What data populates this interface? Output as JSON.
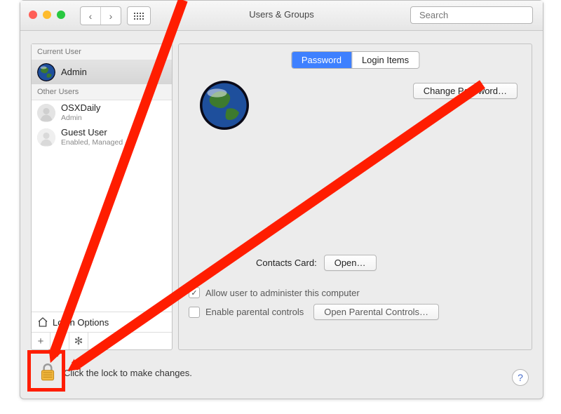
{
  "titlebar": {
    "title": "Users & Groups",
    "search_placeholder": "Search"
  },
  "sidebar": {
    "current_header": "Current User",
    "other_header": "Other Users",
    "users": [
      {
        "name": "Admin",
        "role": ""
      },
      {
        "name": "OSXDaily",
        "role": "Admin"
      },
      {
        "name": "Guest User",
        "role": "Enabled, Managed"
      }
    ],
    "login_options": "Login Options"
  },
  "main": {
    "tabs": [
      {
        "label": "Password",
        "active": true
      },
      {
        "label": "Login Items",
        "active": false
      }
    ],
    "change_password": "Change Password…",
    "contacts_label": "Contacts Card:",
    "open_button": "Open…",
    "allow_admin": "Allow user to administer this computer",
    "allow_admin_checked": true,
    "enable_parental": "Enable parental controls",
    "enable_parental_checked": false,
    "open_parental": "Open Parental Controls…"
  },
  "footer": {
    "lock_hint": "Click the lock to make changes."
  },
  "annotations": {
    "highlight": "lock-icon",
    "arrows_point_to": "lock-icon"
  },
  "colors": {
    "accent": "#3e80ff",
    "annotation_red": "#ff1d00"
  }
}
